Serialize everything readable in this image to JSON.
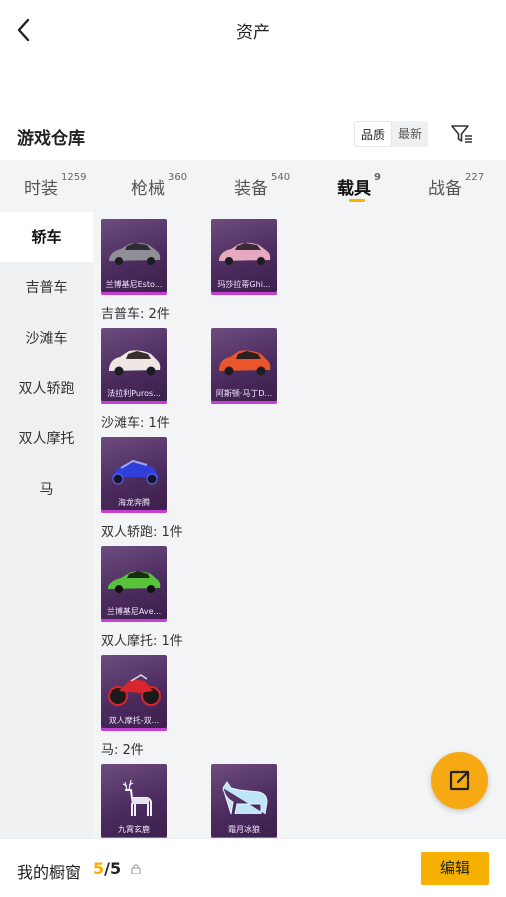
{
  "header": {
    "title": "资产"
  },
  "section": {
    "title": "游戏仓库",
    "sort_options": [
      "品质",
      "最新"
    ]
  },
  "tabs": [
    {
      "label": "时装",
      "count": "1259"
    },
    {
      "label": "枪械",
      "count": "360"
    },
    {
      "label": "装备",
      "count": "540"
    },
    {
      "label": "载具",
      "count": "9"
    },
    {
      "label": "战备",
      "count": "227"
    }
  ],
  "sidebar": [
    "轿车",
    "吉普车",
    "沙滩车",
    "双人轿跑",
    "双人摩托",
    "马"
  ],
  "groups": {
    "jeep": "吉普车: 2件",
    "beach": "沙滩车: 1件",
    "coupe": "双人轿跑: 1件",
    "moto": "双人摩托: 1件",
    "horse": "马: 2件"
  },
  "items": {
    "sedan1": "兰博基尼Esto...",
    "sedan2": "玛莎拉蒂Ghi...",
    "jeep1": "法拉利Puros...",
    "jeep2": "阿斯顿·马丁D...",
    "beach1": "海龙奔腾",
    "coupe1": "兰博基尼Ave...",
    "moto1": "双人摩托-双...",
    "horse1": "九霄玄鹿",
    "horse2": "霜月冰狼"
  },
  "bottom": {
    "label": "我的橱窗",
    "count_current": "5",
    "count_sep": "/",
    "count_total": "5",
    "edit_label": "编辑"
  },
  "colors": {
    "accent": "#f5b000",
    "card_border": "#c53fd0",
    "card_bg": "#4c2b5f"
  },
  "icons": [
    "back-arrow-icon",
    "filter-icon",
    "lock-icon",
    "share-icon"
  ]
}
